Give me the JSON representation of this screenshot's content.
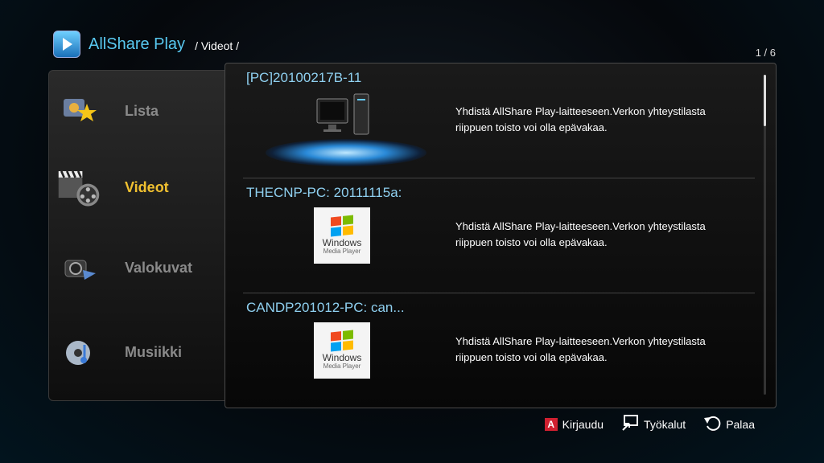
{
  "header": {
    "app_title": "AllShare Play",
    "breadcrumb": "/ Videot /",
    "page_indicator": "1 / 6"
  },
  "sidebar": {
    "items": [
      {
        "label": "Lista",
        "icon": "star-list-icon",
        "active": false
      },
      {
        "label": "Videot",
        "icon": "film-clapper-icon",
        "active": true
      },
      {
        "label": "Valokuvat",
        "icon": "camera-icon",
        "active": false
      },
      {
        "label": "Musiikki",
        "icon": "music-disc-icon",
        "active": false
      }
    ]
  },
  "devices": [
    {
      "name": "[PC]20100217B-11",
      "icon": "pc-icon",
      "description": "Yhdistä AllShare Play-laitteeseen.Verkon yhteystilasta riippuen toisto voi olla epävakaa."
    },
    {
      "name": "THECNP-PC: 20111115a:",
      "icon": "windows-media-player-icon",
      "thumb_line1": "Windows",
      "thumb_line2": "Media Player",
      "description": "Yhdistä AllShare Play-laitteeseen.Verkon yhteystilasta riippuen toisto voi olla epävakaa."
    },
    {
      "name": "CANDP201012-PC: can...",
      "icon": "windows-media-player-icon",
      "thumb_line1": "Windows",
      "thumb_line2": "Media Player",
      "description": "Yhdistä AllShare Play-laitteeseen.Verkon yhteystilasta riippuen toisto voi olla epävakaa."
    }
  ],
  "footer": {
    "login_key": "A",
    "login": "Kirjaudu",
    "tools": "Työkalut",
    "back": "Palaa"
  },
  "colors": {
    "accent_blue": "#58c8f0",
    "active_yellow": "#f0c030",
    "title_blue": "#8fd0f0"
  }
}
